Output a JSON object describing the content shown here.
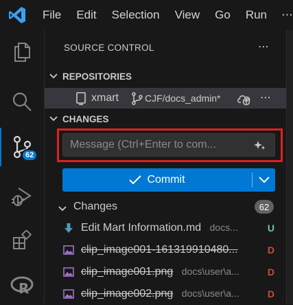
{
  "menu": {
    "items": [
      "File",
      "Edit",
      "Selection",
      "View",
      "Go",
      "Run"
    ],
    "more": "⋯"
  },
  "activity_bar": {
    "items": [
      {
        "icon": "files-icon",
        "label": "Explorer"
      },
      {
        "icon": "search-icon",
        "label": "Search"
      },
      {
        "icon": "source-control-icon",
        "label": "Source Control",
        "active": true
      },
      {
        "icon": "run-debug-icon",
        "label": "Run and Debug"
      },
      {
        "icon": "extensions-icon",
        "label": "Extensions"
      },
      {
        "icon": "r-icon",
        "label": "R"
      }
    ],
    "source_control_badge": "62"
  },
  "sidebar": {
    "title": "SOURCE CONTROL",
    "more": "⋯",
    "repositories": {
      "header": "REPOSITORIES",
      "repo_name": "xmart",
      "branch": "CJF/docs_admin*",
      "more": "⋯"
    },
    "changes_section": {
      "header": "CHANGES",
      "message_placeholder": "Message (Ctrl+Enter to com...",
      "commit_label": "Commit",
      "group_label": "Changes",
      "group_count": "62",
      "files": [
        {
          "name": "Edit Mart Information.md",
          "path": "docs...",
          "status": "U",
          "status_color": "#73c991",
          "deleted": false,
          "icon": "markdown-arrow-icon"
        },
        {
          "name": "clip_image001-161319910480...",
          "path": "",
          "status": "D",
          "status_color": "#c74e39",
          "deleted": true,
          "icon": "image-file-icon"
        },
        {
          "name": "clip_image001.png",
          "path": "docs\\user\\a...",
          "status": "D",
          "status_color": "#c74e39",
          "deleted": true,
          "icon": "image-file-icon"
        },
        {
          "name": "clip_image002.png",
          "path": "docs\\user\\a...",
          "status": "D",
          "status_color": "#c74e39",
          "deleted": true,
          "icon": "image-file-icon"
        }
      ]
    }
  },
  "colors": {
    "accent": "#0078d4",
    "highlight_box": "#e02020",
    "background": "#181818"
  }
}
